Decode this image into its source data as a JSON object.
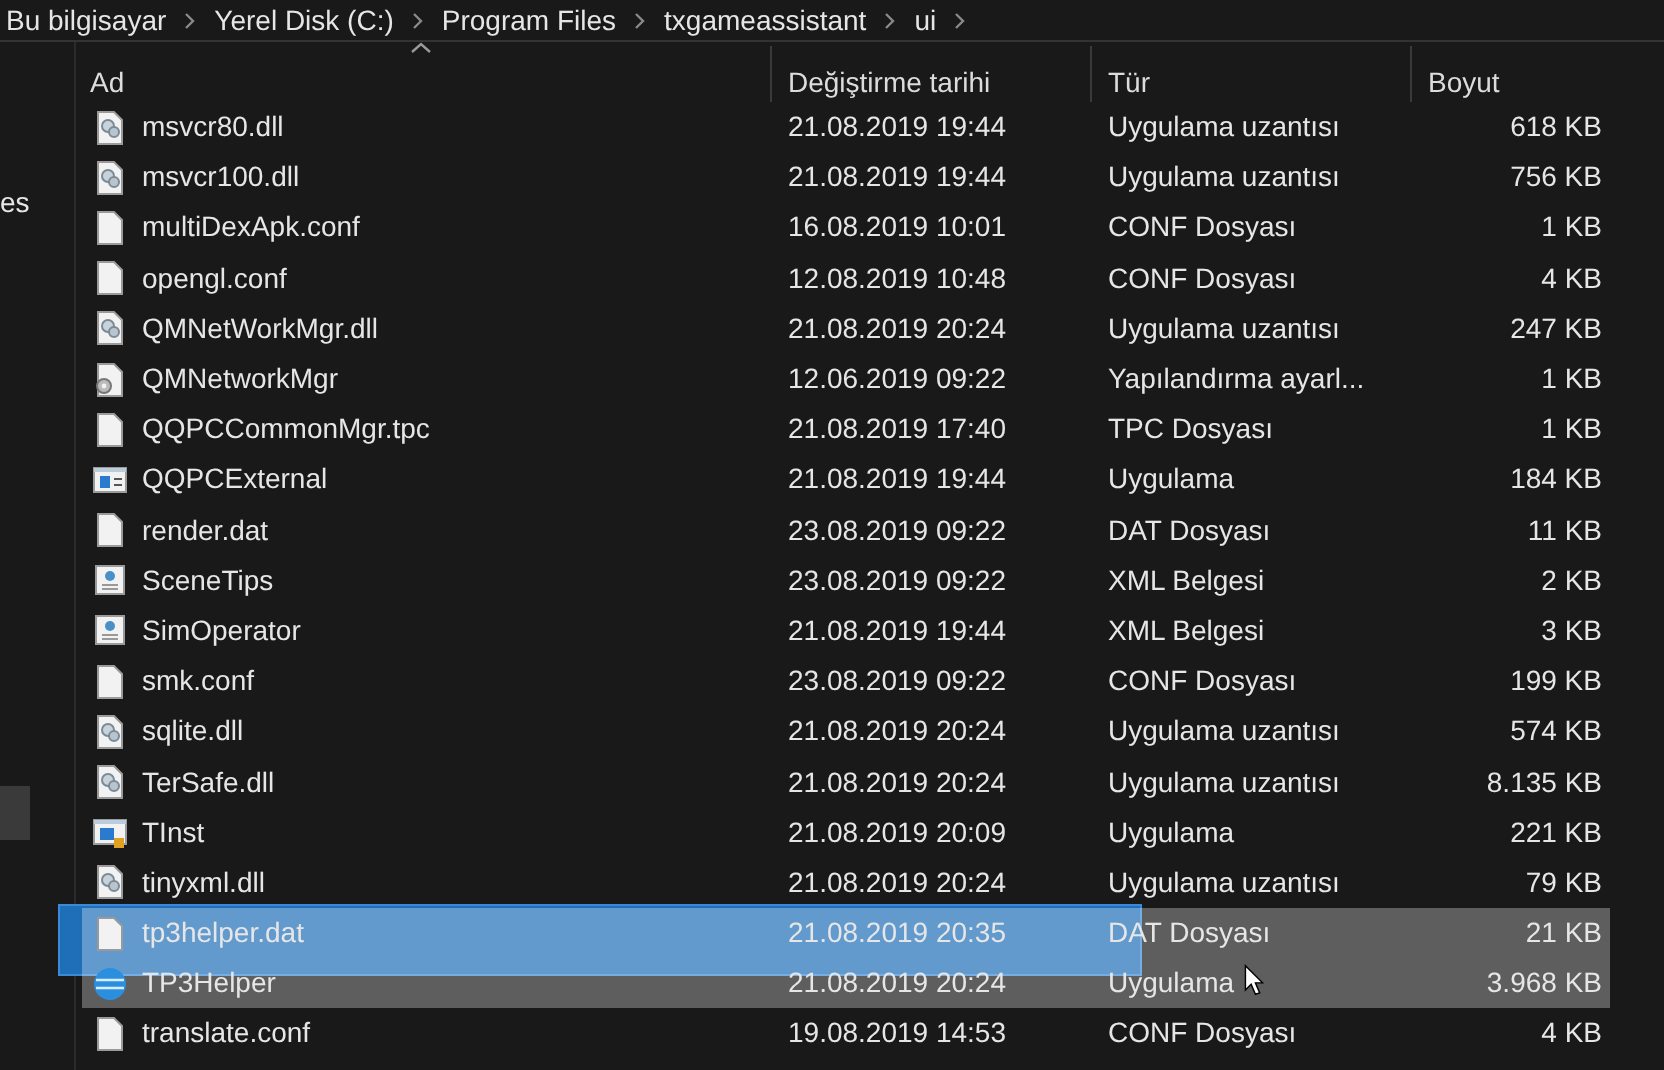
{
  "breadcrumb": [
    "Bu bilgisayar",
    "Yerel Disk (C:)",
    "Program Files",
    "txgameassistant",
    "ui"
  ],
  "sidebar": {
    "items": [
      {
        "label": "es",
        "selected": false
      },
      {
        "selected": true
      }
    ]
  },
  "table": {
    "columns": [
      {
        "label": "Ad",
        "sorted": true
      },
      {
        "label": "Değiştirme tarihi",
        "sorted": false
      },
      {
        "label": "Tür",
        "sorted": false
      },
      {
        "label": "Boyut",
        "sorted": false
      }
    ],
    "rows": [
      {
        "kind": "dll",
        "name": "msvcr80.dll",
        "date": "21.08.2019 19:44",
        "type": "Uygulama uzantısı",
        "size": "618 KB",
        "selected": false
      },
      {
        "kind": "dll",
        "name": "msvcr100.dll",
        "date": "21.08.2019 19:44",
        "type": "Uygulama uzantısı",
        "size": "756 KB",
        "selected": false
      },
      {
        "kind": "file",
        "name": "multiDexApk.conf",
        "date": "16.08.2019 10:01",
        "type": "CONF Dosyası",
        "size": "1 KB",
        "selected": false
      },
      {
        "kind": "file",
        "name": "opengl.conf",
        "date": "12.08.2019 10:48",
        "type": "CONF Dosyası",
        "size": "4 KB",
        "selected": false
      },
      {
        "kind": "dll",
        "name": "QMNetWorkMgr.dll",
        "date": "21.08.2019 20:24",
        "type": "Uygulama uzantısı",
        "size": "247 KB",
        "selected": false
      },
      {
        "kind": "config",
        "name": "QMNetworkMgr",
        "date": "12.06.2019 09:22",
        "type": "Yapılandırma ayarl...",
        "size": "1 KB",
        "selected": false
      },
      {
        "kind": "file",
        "name": "QQPCCommonMgr.tpc",
        "date": "21.08.2019 17:40",
        "type": "TPC Dosyası",
        "size": "1 KB",
        "selected": false
      },
      {
        "kind": "app",
        "name": "QQPCExternal",
        "date": "21.08.2019 19:44",
        "type": "Uygulama",
        "size": "184 KB",
        "selected": false
      },
      {
        "kind": "file",
        "name": "render.dat",
        "date": "23.08.2019 09:22",
        "type": "DAT Dosyası",
        "size": "11 KB",
        "selected": false
      },
      {
        "kind": "xml",
        "name": "SceneTips",
        "date": "23.08.2019 09:22",
        "type": "XML Belgesi",
        "size": "2 KB",
        "selected": false
      },
      {
        "kind": "xml",
        "name": "SimOperator",
        "date": "21.08.2019 19:44",
        "type": "XML Belgesi",
        "size": "3 KB",
        "selected": false
      },
      {
        "kind": "file",
        "name": "smk.conf",
        "date": "23.08.2019 09:22",
        "type": "CONF Dosyası",
        "size": "199 KB",
        "selected": false
      },
      {
        "kind": "dll",
        "name": "sqlite.dll",
        "date": "21.08.2019 20:24",
        "type": "Uygulama uzantısı",
        "size": "574 KB",
        "selected": false
      },
      {
        "kind": "dll",
        "name": "TerSafe.dll",
        "date": "21.08.2019 20:24",
        "type": "Uygulama uzantısı",
        "size": "8.135 KB",
        "selected": false
      },
      {
        "kind": "installer",
        "name": "TInst",
        "date": "21.08.2019 20:09",
        "type": "Uygulama",
        "size": "221 KB",
        "selected": false
      },
      {
        "kind": "dll",
        "name": "tinyxml.dll",
        "date": "21.08.2019 20:24",
        "type": "Uygulama uzantısı",
        "size": "79 KB",
        "selected": false
      },
      {
        "kind": "file",
        "name": "tp3helper.dat",
        "date": "21.08.2019 20:35",
        "type": "DAT Dosyası",
        "size": "21 KB",
        "selected": true
      },
      {
        "kind": "globe",
        "name": "TP3Helper",
        "date": "21.08.2019 20:24",
        "type": "Uygulama",
        "size": "3.968 KB",
        "selected": true
      },
      {
        "kind": "file",
        "name": "translate.conf",
        "date": "19.08.2019 14:53",
        "type": "CONF Dosyası",
        "size": "4 KB",
        "selected": false
      }
    ]
  },
  "drag_selection": true
}
